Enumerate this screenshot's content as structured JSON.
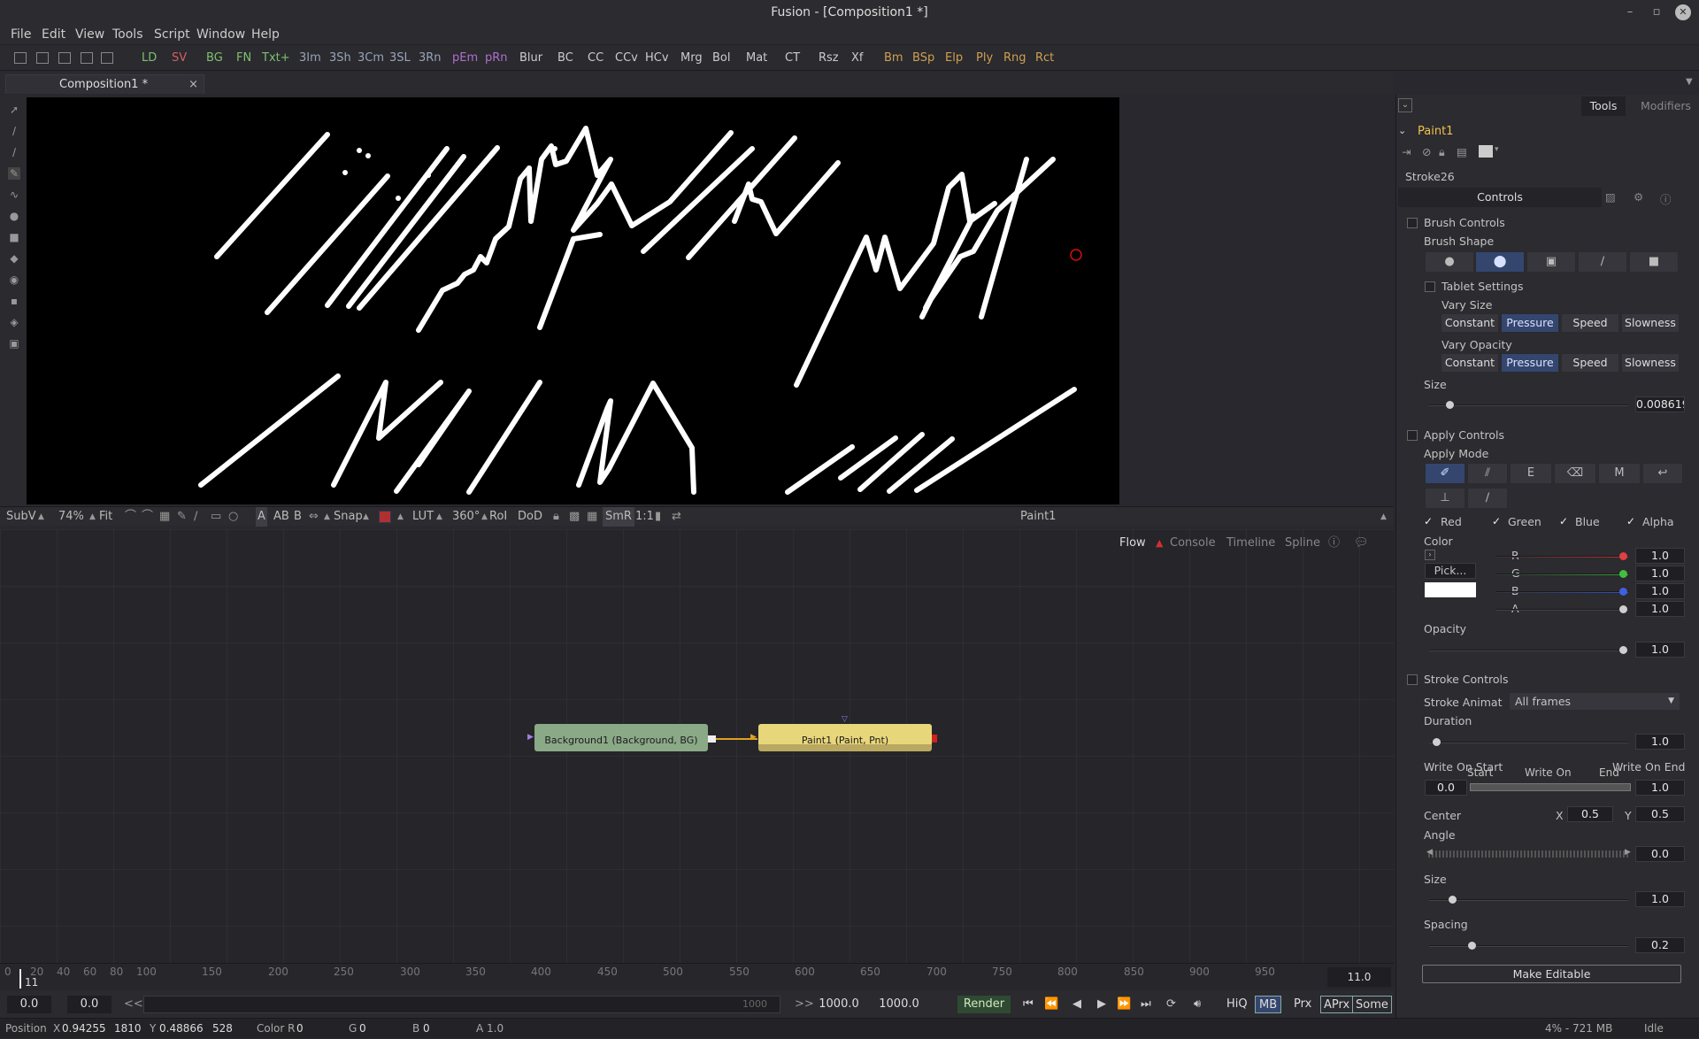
{
  "window": {
    "title": "Fusion - [Composition1 *]",
    "min": "–",
    "max": "▫",
    "close": "✕"
  },
  "menu": [
    "File",
    "Edit",
    "View",
    "Tools",
    "Script",
    "Window",
    "Help"
  ],
  "toolbar": {
    "green": [
      "LD",
      "BG",
      "FN",
      "Txt+"
    ],
    "red": "SV",
    "tools": [
      "3Im",
      "3Sh",
      "3Cm",
      "3SL",
      "3Rn",
      "pEm",
      "pRn",
      "Blur",
      "BC",
      "CC",
      "CCv",
      "HCv",
      "Mrg",
      "Bol",
      "Mat",
      "CT",
      "Rsz",
      "Xf",
      "Bm",
      "BSp",
      "Elp",
      "Ply",
      "Rng",
      "Rct"
    ]
  },
  "tab": {
    "label": "Composition1 *",
    "close": "×"
  },
  "viewer_status": {
    "subv": "SubV",
    "zoom": "74%",
    "fit": "Fit",
    "a": "A",
    "ab": "AB",
    "b": "B",
    "snap": "Snap",
    "lut": "LUT",
    "deg": "360°",
    "roi": "RoI",
    "dod": "DoD",
    "smr": "SmR",
    "ratio": "1:1",
    "node": "Paint1"
  },
  "flow_tabs": [
    "Flow",
    "Console",
    "Timeline",
    "Spline"
  ],
  "nodes": {
    "bg": "Background1  (Background, BG)",
    "paint": "Paint1  (Paint, Pnt)"
  },
  "ruler": {
    "ticks": [
      "0",
      "20",
      "40",
      "60",
      "80",
      "100",
      "150",
      "200",
      "250",
      "300",
      "350",
      "400",
      "450",
      "500",
      "550",
      "600",
      "650",
      "700",
      "750",
      "800",
      "850",
      "900",
      "950"
    ],
    "current": "11",
    "end": "11.0"
  },
  "transport": {
    "start": "0.0",
    "render_start": "0.0",
    "back": "<<",
    "fwd": ">>",
    "scrub_end": "1000",
    "render_end": "1000.0",
    "end": "1000.0",
    "render": "Render",
    "hiq": "HiQ",
    "mb": "MB",
    "prx": "Prx",
    "aprx": "APrx",
    "some": "Some"
  },
  "status": {
    "pos_label": "Position",
    "x_label": "X",
    "x_val": "0.94255",
    "px": "1810",
    "y_label": "Y",
    "y_val": "0.48866",
    "py": "528",
    "color_label": "Color R",
    "r": "0",
    "g_label": "G",
    "g": "0",
    "b_label": "B",
    "b": "0",
    "a_label": "A",
    "a": "1.0",
    "mem": "4% - 721 MB",
    "state": "Idle"
  },
  "panel": {
    "tabs": [
      "Tools",
      "Modifiers"
    ],
    "tool_name": "Paint1",
    "stroke": "Stroke26",
    "controls_tab": "Controls",
    "brush_controls": "Brush Controls",
    "brush_shape": "Brush Shape",
    "tablet_settings": "Tablet Settings",
    "vary_size": "Vary Size",
    "vary_opacity": "Vary Opacity",
    "vary_opts": [
      "Constant",
      "Pressure",
      "Speed",
      "Slowness"
    ],
    "size_label": "Size",
    "size_value": "0.008619",
    "size_fraction": 0.03,
    "apply_controls": "Apply Controls",
    "apply_mode": "Apply Mode",
    "channels": [
      "Red",
      "Green",
      "Blue",
      "Alpha"
    ],
    "color_label": "Color",
    "pick": "Pick...",
    "rgba_labels": [
      "R",
      "G",
      "B",
      "A"
    ],
    "rgba_values": [
      "1.0",
      "1.0",
      "1.0",
      "1.0"
    ],
    "opacity_label": "Opacity",
    "opacity_value": "1.0",
    "stroke_controls": "Stroke Controls",
    "stroke_anim_label": "Stroke Animat",
    "stroke_anim_value": "All frames",
    "duration_label": "Duration",
    "duration_value": "1.0",
    "write_on_start": "Write On Start",
    "start": "Start",
    "write_on": "Write On",
    "end": "End",
    "write_on_end": "Write On End",
    "start_value": "0.0",
    "end_value": "1.0",
    "center_label": "Center",
    "cx_label": "X",
    "cx_value": "0.5",
    "cy_label": "Y",
    "cy_value": "0.5",
    "angle_label": "Angle",
    "angle_value": "0.0",
    "size2_label": "Size",
    "size2_value": "1.0",
    "spacing_label": "Spacing",
    "spacing_value": "0.2",
    "make_editable": "Make Editable"
  },
  "colors": {
    "accent": "#34466e",
    "bg_node": "#8aa987",
    "paint_node": "#e8d67a",
    "wire": "#e0a020"
  }
}
